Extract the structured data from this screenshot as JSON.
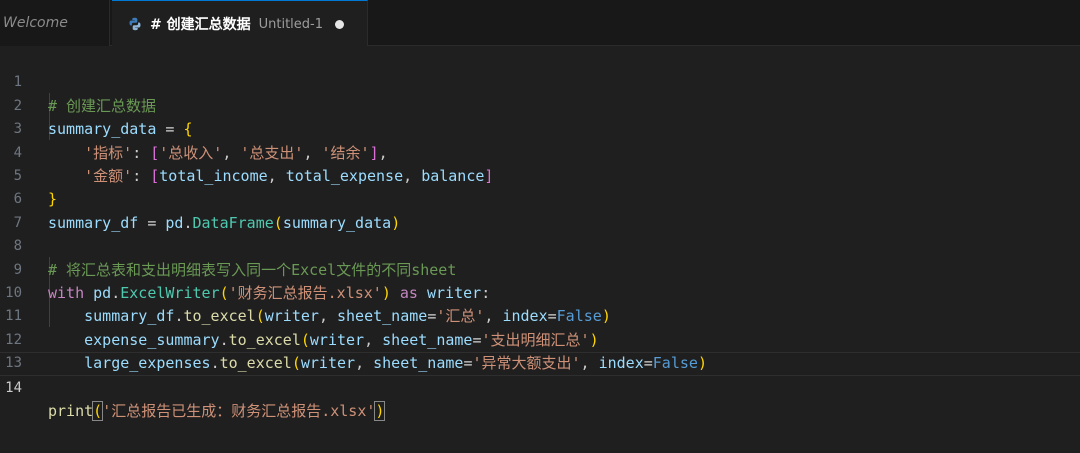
{
  "tabs": {
    "welcome_label": "Welcome",
    "active_title": "# 创建汇总数据",
    "active_desc": "Untitled-1"
  },
  "editor": {
    "language_icon": "python-icon",
    "active_line": "14",
    "lines": [
      {
        "num": "1",
        "text": "# 创建汇总数据"
      },
      {
        "num": "2",
        "text": "summary_data = {"
      },
      {
        "num": "3",
        "text": "    '指标': ['总收入', '总支出', '结余'],"
      },
      {
        "num": "4",
        "text": "    '金额': [total_income, total_expense, balance]"
      },
      {
        "num": "5",
        "text": "}"
      },
      {
        "num": "6",
        "text": "summary_df = pd.DataFrame(summary_data)"
      },
      {
        "num": "7",
        "text": ""
      },
      {
        "num": "8",
        "text": "# 将汇总表和支出明细表写入同一个Excel文件的不同sheet"
      },
      {
        "num": "9",
        "text": "with pd.ExcelWriter('财务汇总报告.xlsx') as writer:"
      },
      {
        "num": "10",
        "text": "    summary_df.to_excel(writer, sheet_name='汇总', index=False)"
      },
      {
        "num": "11",
        "text": "    expense_summary.to_excel(writer, sheet_name='支出明细汇总')"
      },
      {
        "num": "12",
        "text": "    large_expenses.to_excel(writer, sheet_name='异常大额支出', index=False)"
      },
      {
        "num": "13",
        "text": ""
      },
      {
        "num": "14",
        "text": "print('汇总报告已生成：财务汇总报告.xlsx')"
      }
    ]
  },
  "colors": {
    "comment": "#6a9955",
    "variable": "#9cdcfe",
    "string": "#ce9178",
    "keyword": "#c586c0",
    "function": "#dcdcaa",
    "class": "#4ec9b0",
    "constant": "#569cd6",
    "brace": "#ffd700",
    "bracket": "#da70d6",
    "tab_accent": "#0078d4"
  }
}
